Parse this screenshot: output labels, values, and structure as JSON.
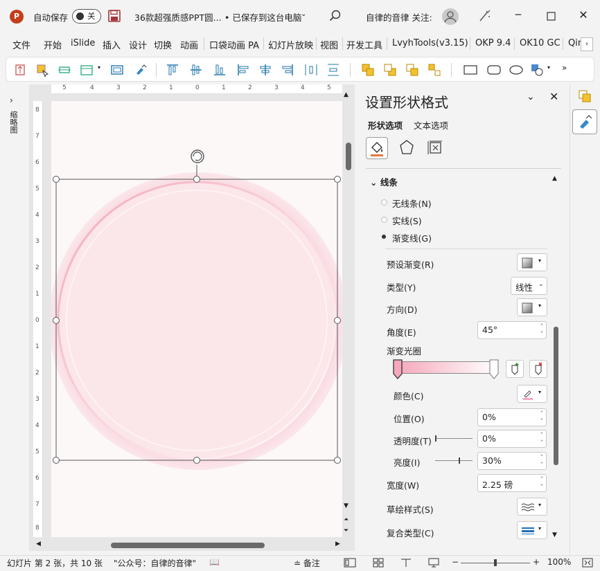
{
  "titlebar": {
    "app_icon": "powerpoint-icon",
    "autosave_label": "自动保存",
    "autosave_state": "关",
    "doc_title": "36款超强质感PPT圆...",
    "doc_status": "• 已保存到这台电脑",
    "dropdown": "⌄",
    "account_label": "自律的音律 关注:",
    "icons": [
      "save-icon",
      "search-icon",
      "avatar",
      "designer-icon"
    ],
    "window_controls": {
      "minimize": "─",
      "maximize": "☐",
      "close": "✕"
    }
  },
  "ribbon_tabs": [
    "文件",
    "开始",
    "iSlide",
    "插入",
    "设计",
    "切换",
    "动画",
    "口袋动画 PA",
    "幻灯片放映",
    "视图",
    "开发工具",
    "LvyhTools(v3.15)",
    "OKP 9.4",
    "OK10 GC",
    "Qin"
  ],
  "ribbon_more": "›",
  "toolbar_more": "»",
  "left_panel": {
    "expand": "›",
    "label": "缩略图"
  },
  "ruler": {
    "h_ticks": [
      "5",
      "4",
      "3",
      "2",
      "1",
      "0",
      "1",
      "2",
      "3",
      "4",
      "5"
    ],
    "v_ticks": [
      "8",
      "7",
      "6",
      "5",
      "4",
      "3",
      "2",
      "1",
      "0",
      "1",
      "2",
      "3",
      "4",
      "5",
      "6",
      "7",
      "8"
    ]
  },
  "slide": {
    "rotate_icon": "rotate-handle-icon",
    "shape": "circle"
  },
  "format_pane": {
    "title": "设置形状格式",
    "tabs": {
      "shape": "形状选项",
      "text": "文本选项"
    },
    "categories": [
      "fill-line-icon",
      "effects-icon",
      "size-properties-icon"
    ],
    "section": "线条",
    "line_options": [
      {
        "label": "无线条(N)",
        "selected": false
      },
      {
        "label": "实线(S)",
        "selected": false
      },
      {
        "label": "渐变线(G)",
        "selected": true
      }
    ],
    "fields": {
      "preset": "预设渐变(R)",
      "type_label": "类型(Y)",
      "type_value": "线性",
      "direction": "方向(D)",
      "angle_label": "角度(E)",
      "angle_value": "45°",
      "stops_label": "渐变光圈",
      "color_label": "颜色(C)",
      "position_label": "位置(O)",
      "position_value": "0%",
      "transparency_label": "透明度(T)",
      "transparency_value": "0%",
      "brightness_label": "亮度(I)",
      "brightness_value": "30%",
      "width_label": "宽度(W)",
      "width_value": "2.25 磅",
      "sketch_label": "草绘样式(S)",
      "compound_label": "复合类型(C)"
    },
    "colors": {
      "gradient_start": "#f5a8bb",
      "gradient_end": "#ffffff",
      "accent": "#c43e1c"
    }
  },
  "statusbar": {
    "slide_info": "幻灯片 第 2 张，共 10 张",
    "author": "\"公众号：自律的音律\"",
    "notes": "备注",
    "zoom": "100%",
    "minus": "−",
    "plus": "+"
  }
}
